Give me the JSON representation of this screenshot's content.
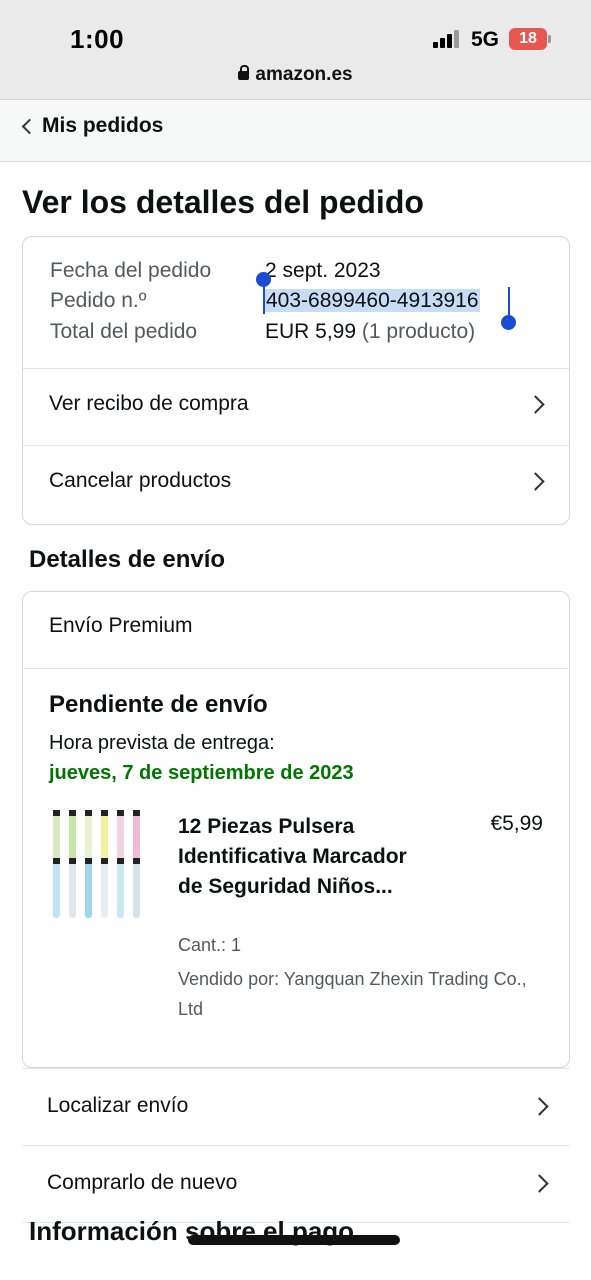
{
  "status_bar": {
    "time": "1:00",
    "network": "5G",
    "battery": "18"
  },
  "browser": {
    "url": "amazon.es"
  },
  "nav": {
    "back_label": "Mis pedidos"
  },
  "page_title": "Ver los detalles del pedido",
  "order_summary": {
    "date_label": "Fecha del pedido",
    "date_value": "2 sept. 2023",
    "number_label": "Pedido n.º",
    "number_value": "403-6899460-4913916",
    "total_label": "Total del pedido",
    "total_value": "EUR 5,99",
    "total_count": "(1 producto)"
  },
  "order_actions": [
    {
      "label": "Ver recibo de compra"
    },
    {
      "label": "Cancelar productos"
    }
  ],
  "shipping": {
    "heading": "Detalles de envío",
    "method": "Envío Premium",
    "status": "Pendiente de envío",
    "eta_label": "Hora prevista de entrega:",
    "eta_date": "jueves, 7 de septiembre de 2023",
    "item": {
      "title": "12 Piezas Pulsera Identificativa Marcador de Seguridad Niños...",
      "price": "€5,99",
      "quantity": "Cant.: 1",
      "seller": "Vendido por: Yangquan Zhexin Trading Co., Ltd"
    }
  },
  "shipment_actions": [
    {
      "label": "Localizar envío"
    },
    {
      "label": "Comprarlo de nuevo"
    }
  ],
  "payment_heading": "Información sobre el pago",
  "colors": {
    "accent_green": "#007600",
    "selection_blue": "#1a4cd3",
    "selection_bg": "#c6dcf7",
    "border": "#d5d9d9"
  }
}
